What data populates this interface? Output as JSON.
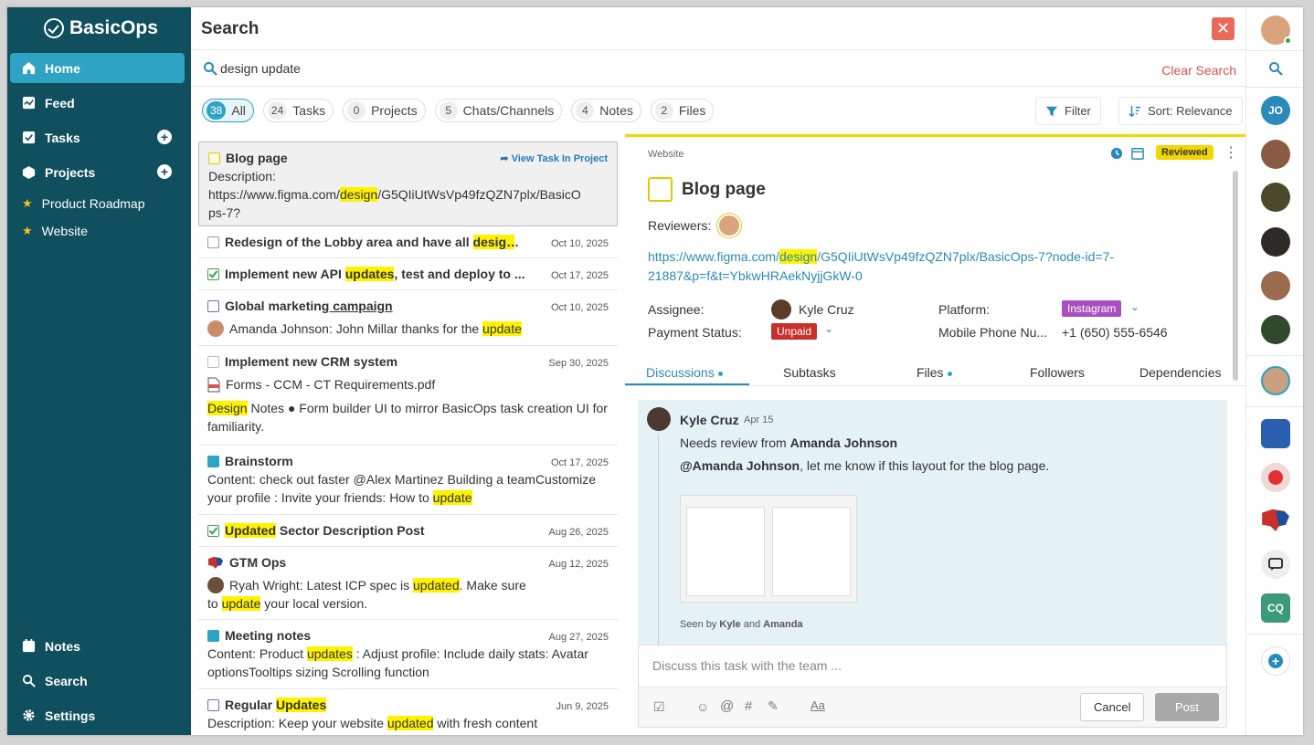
{
  "app": {
    "brand": "BasicOps"
  },
  "sidebar": {
    "nav": [
      {
        "label": "Home"
      },
      {
        "label": "Feed"
      },
      {
        "label": "Tasks"
      },
      {
        "label": "Projects"
      }
    ],
    "projects": [
      {
        "label": "Product Roadmap"
      },
      {
        "label": "Website"
      }
    ],
    "bottom": [
      {
        "label": "Notes"
      },
      {
        "label": "Search"
      },
      {
        "label": "Settings"
      }
    ]
  },
  "header": {
    "title": "Search",
    "close": "✕"
  },
  "search": {
    "query": "design update",
    "clear_label": "Clear Search"
  },
  "filters": [
    {
      "count": "38",
      "label": "All"
    },
    {
      "count": "24",
      "label": "Tasks"
    },
    {
      "count": "0",
      "label": "Projects"
    },
    {
      "count": "5",
      "label": "Chats/Channels"
    },
    {
      "count": "4",
      "label": "Notes"
    },
    {
      "count": "2",
      "label": "Files"
    }
  ],
  "toolbar": {
    "filter_label": "Filter",
    "sort_label": "Sort: Relevance"
  },
  "results": [
    {
      "title": "Blog page",
      "link": "View Task In Project",
      "desc_prefix": "Description:",
      "line1_a": "https://www.figma.com/",
      "line1_hl": "design",
      "line1_b": "/G5QIiUtWsVp49fzQZN7plx/BasicO",
      "line2": "ps-7?"
    },
    {
      "title_a": "Redesign of the Lobby area and have all ",
      "title_hl": "design",
      "title_b": " ...",
      "date": "Oct 10, 2025"
    },
    {
      "title_a": "Implement new API ",
      "title_hl": "updates",
      "title_b": ", test and deploy to ...",
      "date": "Oct 17, 2025"
    },
    {
      "title_a": "Global marketing",
      "title_u": " campaign",
      "date": "Oct 10, 2025",
      "text_a": "Amanda Johnson: John Millar thanks for the ",
      "text_hl": "update"
    },
    {
      "title": "Implement new CRM system",
      "date": "Sep 30, 2025",
      "file": "Forms - CCM - CT Requirements.pdf",
      "note_hl": "Design",
      "note_a": " Notes ● Form builder UI to mirror BasicOps task creation UI for familiarity."
    },
    {
      "title": "Brainstorm",
      "date": "Oct 17, 2025",
      "text_a": "Content: check out faster @Alex Martinez Building a teamCustomize your profile : Invite your friends: How to ",
      "text_hl": "update"
    },
    {
      "title_hl": "Updated",
      "title_b": " Sector Description Post",
      "date": "Aug 26, 2025"
    },
    {
      "title": "GTM Ops",
      "date": "Aug 12, 2025",
      "text_a": "Ryah Wright: Latest ICP spec is ",
      "text_hl": "updated",
      "text_b": ". Make sure",
      "line2_a": "to ",
      "line2_hl": "update",
      "line2_b": " your local version."
    },
    {
      "title": "Meeting notes",
      "date": "Aug 27, 2025",
      "text_a": "Content: Product ",
      "text_hl": "updates",
      "text_b": " : Adjust profile: Include daily stats: Avatar optionsTooltips sizing Scrolling function"
    },
    {
      "title_a": "Regular ",
      "title_hl": "Updates",
      "date": "Jun 9, 2025",
      "text_a": "Description: Keep your website ",
      "text_hl": "updated",
      "text_b": " with fresh content"
    }
  ],
  "detail": {
    "project": "Website",
    "badge": "Reviewed",
    "title": "Blog page",
    "reviewers_label": "Reviewers:",
    "link_a": "https://www.figma.com/",
    "link_hl": "design",
    "link_b": "/G5QIiUtWsVp49fzQZN7plx/BasicOps-7?node-id=7-21887&p=f&t=YbkwHRAekNyjjGkW-0",
    "assignee_label": "Assignee:",
    "assignee": "Kyle Cruz",
    "platform_label": "Platform:",
    "platform": "Instagram",
    "payment_label": "Payment Status:",
    "payment": "Unpaid",
    "phone_label": "Mobile Phone Nu...",
    "phone": "+1 (650) 555-6546",
    "tabs": [
      "Discussions",
      "Subtasks",
      "Files",
      "Followers",
      "Dependencies"
    ],
    "comment": {
      "author": "Kyle Cruz",
      "date": "Apr 15",
      "line1_a": "Needs review from ",
      "line1_b": "Amanda Johnson",
      "line2_a": "@Amanda Johnson",
      "line2_b": ", let me know if this layout for the blog page.",
      "seen_a": "Seen by ",
      "seen_b": "Kyle",
      "seen_c": " and ",
      "seen_d": "Amanda"
    },
    "composer": {
      "placeholder": "Discuss this task with the team ...",
      "cancel": "Cancel",
      "post": "Post"
    }
  },
  "rail": {
    "initials_jo": "JO",
    "initials_cq": "CQ"
  },
  "colors": {
    "sidebar": "#0f4f5e",
    "accent": "#2ea3c3",
    "highlight": "#fff200",
    "reviewed": "#f2d600"
  }
}
